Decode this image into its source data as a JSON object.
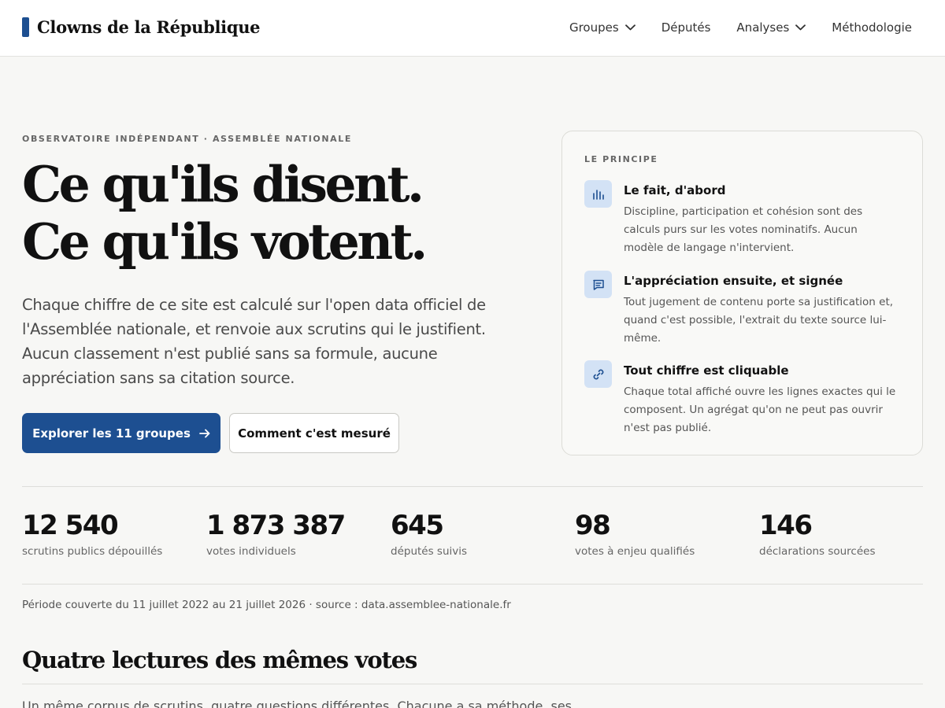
{
  "header": {
    "brand": "Clowns de la République",
    "nav": [
      {
        "label": "Groupes",
        "has_dropdown": true
      },
      {
        "label": "Députés",
        "has_dropdown": false
      },
      {
        "label": "Analyses",
        "has_dropdown": true
      },
      {
        "label": "Méthodologie",
        "has_dropdown": false
      }
    ]
  },
  "hero": {
    "eyebrow": "OBSERVATOIRE INDÉPENDANT · ASSEMBLÉE NATIONALE",
    "headline_line1": "Ce qu'ils disent.",
    "headline_line2": "Ce qu'ils votent.",
    "lead": "Chaque chiffre de ce site est calculé sur l'open data officiel de l'Assemblée nationale, et renvoie aux scrutins qui le justifient. Aucun classement n'est publié sans sa formule, aucune appréciation sans sa citation source.",
    "primary_button": "Explorer les 11 groupes",
    "secondary_button": "Comment c'est mesuré"
  },
  "principle": {
    "title": "LE PRINCIPE",
    "items": [
      {
        "icon": "bar-chart-icon",
        "title": "Le fait, d'abord",
        "text": "Discipline, participation et cohésion sont des calculs purs sur les votes nominatifs. Aucun modèle de langage n'intervient."
      },
      {
        "icon": "message-icon",
        "title": "L'appréciation ensuite, et signée",
        "text": "Tout jugement de contenu porte sa justification et, quand c'est possible, l'extrait du texte source lui-même."
      },
      {
        "icon": "link-icon",
        "title": "Tout chiffre est cliquable",
        "text": "Chaque total affiché ouvre les lignes exactes qui le composent. Un agrégat qu'on ne peut pas ouvrir n'est pas publié."
      }
    ]
  },
  "stats": [
    {
      "value": "12 540",
      "label": "scrutins publics dépouillés"
    },
    {
      "value": "1 873 387",
      "label": "votes individuels"
    },
    {
      "value": "645",
      "label": "députés suivis"
    },
    {
      "value": "98",
      "label": "votes à enjeu qualifiés"
    },
    {
      "value": "146",
      "label": "déclarations sourcées"
    }
  ],
  "period": "Période couverte du 11 juillet 2022 au 21 juillet 2026 · source : data.assemblee-nationale.fr",
  "section": {
    "title": "Quatre lectures des mêmes votes",
    "text": "Un même corpus de scrutins, quatre questions différentes. Chacune a sa méthode, ses"
  },
  "colors": {
    "accent": "#1d4f91",
    "icon_bg": "#d3e2f5",
    "background": "#f7f7f5"
  }
}
